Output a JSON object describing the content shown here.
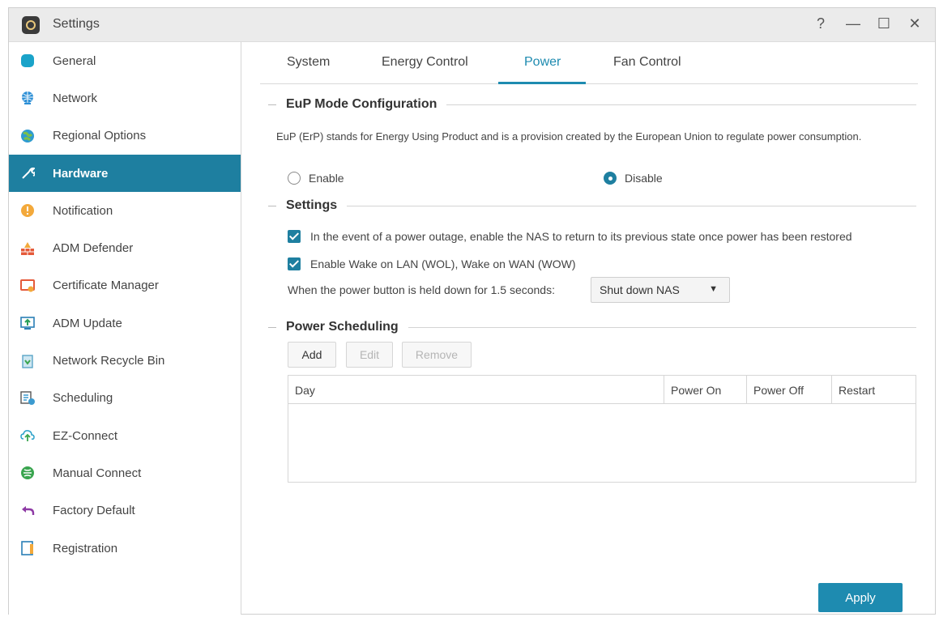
{
  "window": {
    "title": "Settings",
    "controls": {
      "help": "?",
      "minimize": "—",
      "maximize": "☐",
      "close": "✕"
    }
  },
  "sidebar": {
    "items": [
      {
        "label": "General",
        "icon": "general-icon",
        "color": "#1aa3c9"
      },
      {
        "label": "Network",
        "icon": "network-globe-icon",
        "color": "#2c8fd6"
      },
      {
        "label": "Regional Options",
        "icon": "globe-icon",
        "color": "#2e9bd0"
      },
      {
        "label": "Hardware",
        "icon": "hardware-wrench-icon",
        "color": "#ffffff",
        "active": true
      },
      {
        "label": "Notification",
        "icon": "exclamation-icon",
        "color": "#f3a93b"
      },
      {
        "label": "ADM Defender",
        "icon": "firewall-icon",
        "color": "#e55a3a"
      },
      {
        "label": "Certificate Manager",
        "icon": "certificate-icon",
        "color": "#e55a3a"
      },
      {
        "label": "ADM Update",
        "icon": "update-icon",
        "color": "#2a7fb6"
      },
      {
        "label": "Network Recycle Bin",
        "icon": "recycle-bin-icon",
        "color": "#5aa5c7"
      },
      {
        "label": "Scheduling",
        "icon": "scheduling-icon",
        "color": "#3c9bd0"
      },
      {
        "label": "EZ-Connect",
        "icon": "cloud-upload-icon",
        "color": "#2aa0c9"
      },
      {
        "label": "Manual Connect",
        "icon": "manual-connect-icon",
        "color": "#3aa54f"
      },
      {
        "label": "Factory Default",
        "icon": "undo-arrow-icon",
        "color": "#8e3aa5"
      },
      {
        "label": "Registration",
        "icon": "registration-icon",
        "color": "#2a7fb6"
      }
    ]
  },
  "tabs": [
    {
      "label": "System"
    },
    {
      "label": "Energy Control"
    },
    {
      "label": "Power",
      "active": true
    },
    {
      "label": "Fan Control"
    }
  ],
  "eup": {
    "title": "EuP Mode Configuration",
    "description": "EuP (ErP) stands for Energy Using Product and is a provision created by the European Union to regulate power consumption.",
    "enable_label": "Enable",
    "disable_label": "Disable",
    "selected": "Disable"
  },
  "settings": {
    "title": "Settings",
    "power_outage_label": "In the event of a power outage, enable the NAS to return to its previous state once power has been restored",
    "wol_label": "Enable Wake on LAN (WOL), Wake on WAN (WOW)",
    "power_button_label": "When the power button is held down for 1.5 seconds:",
    "power_button_value": "Shut down NAS"
  },
  "scheduling": {
    "title": "Power Scheduling",
    "add_label": "Add",
    "edit_label": "Edit",
    "remove_label": "Remove",
    "columns": [
      "Day",
      "Power On",
      "Power Off",
      "Restart"
    ],
    "rows": []
  },
  "apply_label": "Apply",
  "colors": {
    "accent": "#1e8bb0",
    "sidebar_active": "#1e7fa0"
  }
}
